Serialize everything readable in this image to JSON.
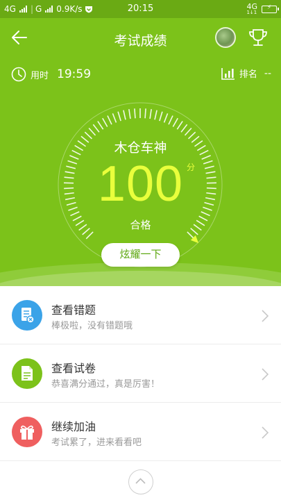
{
  "status_bar": {
    "sim1_label": "4G",
    "sim2_label": "G",
    "network_speed": "0.9K/s",
    "time": "20:15",
    "right_network": "4G",
    "right_sub": "1↓1"
  },
  "header": {
    "title": "考试成绩",
    "back_icon": "back-arrow-icon",
    "trophy_icon": "trophy-icon"
  },
  "stats": {
    "time_label": "用时",
    "time_value": "19:59",
    "rank_label": "排名",
    "rank_value": "--"
  },
  "result": {
    "username": "木仓车神",
    "score": "100",
    "score_unit": "分",
    "score_fraction": 1.0,
    "status": "合格",
    "share_label": "炫耀一下"
  },
  "colors": {
    "hero_green": "#7cc21a",
    "score_yellow": "#e9ff3c",
    "icon_blue": "#3ba3e8",
    "icon_green": "#7cc21a",
    "icon_red": "#ef5f5f"
  },
  "list": [
    {
      "title": "查看错题",
      "subtitle": "棒极啦，没有错题哦",
      "icon": "wrong-questions-icon",
      "color": "#3ba3e8"
    },
    {
      "title": "查看试卷",
      "subtitle": "恭喜满分通过，真是厉害！",
      "icon": "exam-paper-icon",
      "color": "#7cc21a"
    },
    {
      "title": "继续加油",
      "subtitle": "考试累了，进来看看吧",
      "icon": "gift-icon",
      "color": "#ef5f5f"
    }
  ]
}
